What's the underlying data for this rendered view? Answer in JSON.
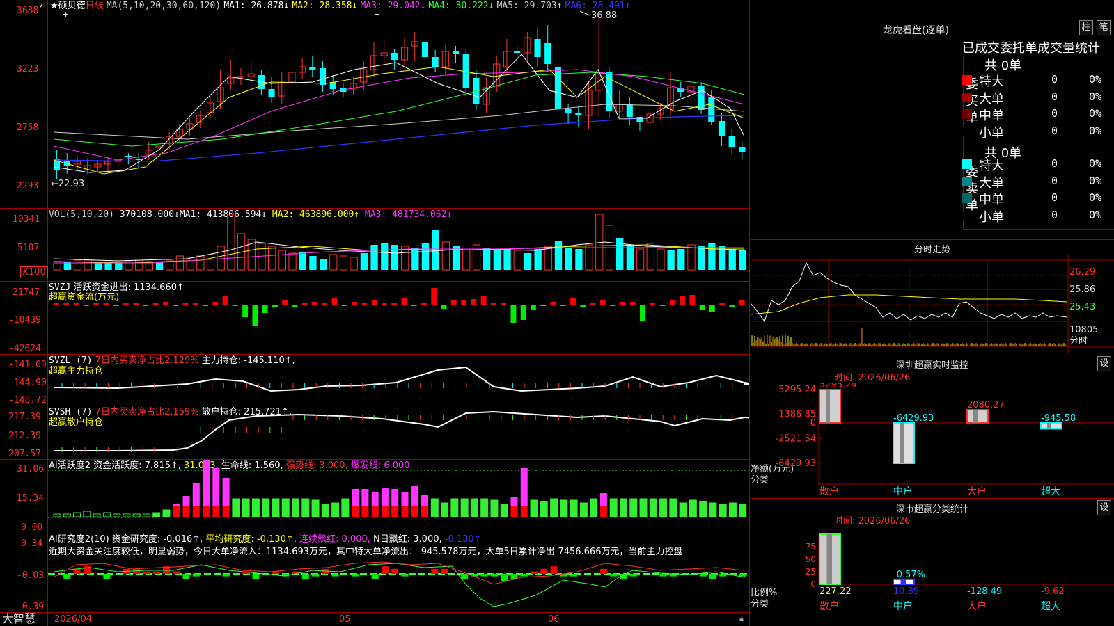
{
  "stock": {
    "star": "★",
    "name": "硕贝德",
    "period": "日线"
  },
  "main_chart": {
    "ma_header": "MA(5,10,20,30,60,120)",
    "ma": [
      {
        "label": "MA1: 26.878↓",
        "color": "#ffffff"
      },
      {
        "label": "MA2: 28.358↓",
        "color": "#ffff00"
      },
      {
        "label": "MA3: 29.042↓",
        "color": "#ff33ff"
      },
      {
        "label": "MA4: 30.222↓",
        "color": "#33ff33"
      },
      {
        "label": "MA5: 29.703↑",
        "color": "#cccccc"
      },
      {
        "label": "MA6: 28.491↑",
        "color": "#3333ff"
      }
    ],
    "y_ticks": [
      "3688",
      "3223",
      "2758",
      "2293"
    ],
    "high_label": "36.88",
    "low_label": "←22.93"
  },
  "vol_panel": {
    "header": "VOL(5,10,20)",
    "value": "370108.000↓",
    "ma": [
      {
        "label": "MA1: 413806.594↓",
        "color": "#ffffff"
      },
      {
        "label": "MA2: 463896.000↑",
        "color": "#ffff00"
      },
      {
        "label": "MA3: 481734.062↓",
        "color": "#ff33ff"
      }
    ],
    "y_ticks": [
      "10341",
      "5107"
    ],
    "unit": "X100"
  },
  "svzj_panel": {
    "header": "SVZJ",
    "label": "活跃资金进出: 1134.660↑",
    "subtitle": "超赢资金流(万元)",
    "y_ticks": [
      "21747",
      "-10439",
      "-42624"
    ]
  },
  "svzl_panel": {
    "header": "SVZL (7)",
    "pct": "7日内买卖净占比2.129%",
    "label": "主力持仓: -145.110↑,",
    "subtitle": "超赢主力持仓",
    "y_ticks": [
      "-141.09",
      "-144.90",
      "-148.72"
    ]
  },
  "svsh_panel": {
    "header": "SVSH (7)",
    "pct": "7日内买卖净占比2.159%",
    "label": "散户持仓: 215.721↑,",
    "subtitle": "超赢散户持仓",
    "y_ticks": [
      "217.39",
      "212.39",
      "207.57"
    ]
  },
  "ai_active_panel": {
    "header": "AI活跃度2",
    "labels": [
      {
        "text": "资金活跃度: 7.815↑,",
        "color": "#ffffff"
      },
      {
        "text": "31.063,",
        "color": "#ffff00"
      },
      {
        "text": "生命线: 1.560,",
        "color": "#ffffff"
      },
      {
        "text": "强势线: 3.000,",
        "color": "#ff3030"
      },
      {
        "text": "爆发线: 6.000,",
        "color": "#ff33ff"
      }
    ],
    "y_ticks": [
      "31.06",
      "15.34",
      "0.00"
    ]
  },
  "ai_research_panel": {
    "header": "AI研究度2(10)",
    "labels": [
      {
        "text": "资金研究度: -0.016↑,",
        "color": "#ffffff"
      },
      {
        "text": "平均研究度: -0.130↑,",
        "color": "#ffff00"
      },
      {
        "text": "连续飘红: 0.000,",
        "color": "#ff33ff"
      },
      {
        "text": "N日飘红: 3.000,",
        "color": "#ffffff"
      },
      {
        "text": "-0.130↑",
        "color": "#3333ff"
      }
    ],
    "commentary": "近期大资金关注度较低，明显弱势，今日大单净流入：1134.693万元，其中特大单净流出：-945.578万元，大单5日累计净出-7456.666万元，当前主力控盘",
    "y_ticks": [
      "0.34",
      "-0.03",
      "-0.39"
    ]
  },
  "bottom_bar": {
    "brand": "大智慧",
    "date": "2026/04",
    "month_05": "05",
    "month_06": "06"
  },
  "dragon_tiger": {
    "title": "龙虎看盘(逐单)",
    "btn_bar": "柱",
    "btn_line": "笔",
    "tabs": [
      "已成交",
      "委托单",
      "成交量统计"
    ],
    "buy": {
      "side_label": "委买单",
      "total": "共 0单",
      "rows": [
        {
          "name": "特大",
          "count": "0",
          "pct": "0%",
          "color": "#ff0000"
        },
        {
          "name": "大单",
          "count": "0",
          "pct": "0%",
          "color": "#a00000"
        },
        {
          "name": "中单",
          "count": "0",
          "pct": "0%",
          "color": "#700000"
        },
        {
          "name": "小单",
          "count": "0",
          "pct": "0%",
          "color": "#000000"
        }
      ]
    },
    "sell": {
      "side_label": "委卖单",
      "total": "共 0单",
      "rows": [
        {
          "name": "特大",
          "count": "0",
          "pct": "0%",
          "color": "#00ffff"
        },
        {
          "name": "大单",
          "count": "0",
          "pct": "0%",
          "color": "#008888"
        },
        {
          "name": "中单",
          "count": "0",
          "pct": "0%",
          "color": "#006666"
        },
        {
          "name": "小单",
          "count": "0",
          "pct": "0%",
          "color": "#000000"
        }
      ]
    }
  },
  "intraday": {
    "title": "分时走势",
    "prices": [
      "26.29",
      "25.86",
      "25.43"
    ],
    "vol_label": "10805",
    "footer": "分时"
  },
  "sz_monitor": {
    "title": "深圳超赢实时监控",
    "settings_btn": "设",
    "time_label": "时间: 2026/06/26",
    "y_ticks": [
      "5295.24",
      "1386.85",
      "0",
      "-2521.54",
      "-6429.93"
    ],
    "ylabel": "净额(万元)",
    "xlabel": "分类",
    "chart_data": {
      "type": "bar",
      "categories": [
        "散户",
        "中户",
        "大户",
        "超大"
      ],
      "values": [
        5295.24,
        -6429.93,
        2080.27,
        -945.58
      ],
      "value_labels": [
        "5295.24",
        "-6429.93",
        "2080.27",
        "-945.58"
      ],
      "ylim": [
        -6429.93,
        5295.24
      ]
    }
  },
  "sz_classify": {
    "title": "深市超赢分类统计",
    "settings_btn": "设",
    "time_label": "时间: 2026/06/26",
    "y_ticks": [
      "75",
      "50",
      "25",
      "0"
    ],
    "ylabel": "比例%",
    "xlabel": "分类",
    "pct_label": "-0.57%",
    "chart_data": {
      "type": "bar",
      "categories": [
        "散户",
        "中户",
        "大户",
        "超大"
      ],
      "values": [
        227.22,
        10.89,
        -128.49,
        -9.62
      ],
      "value_labels": [
        "227.22",
        "10.89",
        "-128.49",
        "-9.62"
      ],
      "ylim": [
        0,
        100
      ]
    }
  }
}
